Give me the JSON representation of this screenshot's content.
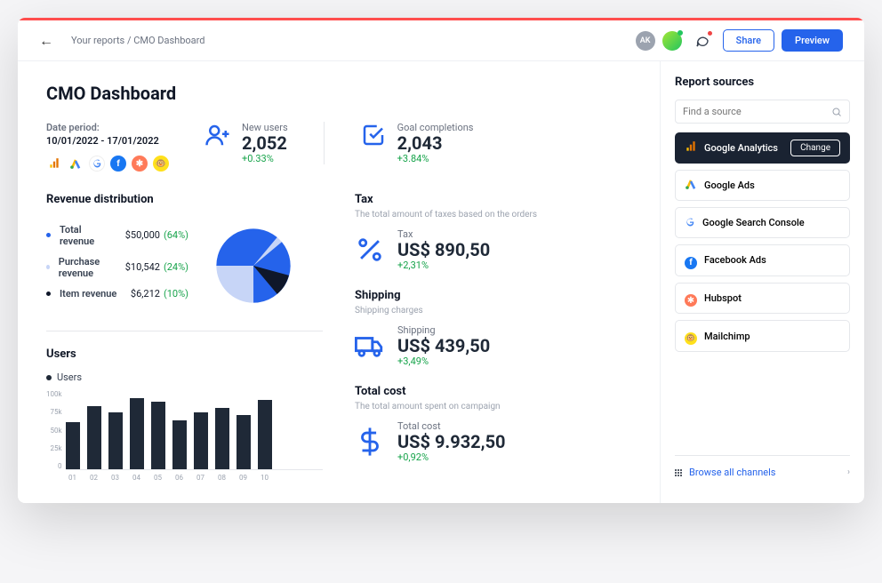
{
  "breadcrumb": "Your reports / CMO Dashboard",
  "header": {
    "avatar1": "AK",
    "share": "Share",
    "preview": "Preview"
  },
  "page_title": "CMO Dashboard",
  "date": {
    "label": "Date period:",
    "value": "10/01/2022 - 17/01/2022"
  },
  "top_sources": [
    "google-analytics",
    "google-ads",
    "google",
    "facebook",
    "hubspot",
    "mailchimp"
  ],
  "kpi": {
    "new_users": {
      "label": "New users",
      "value": "2,052",
      "delta": "+0.33%"
    },
    "goal": {
      "label": "Goal completions",
      "value": "2,043",
      "delta": "+3.84%"
    }
  },
  "revenue": {
    "title": "Revenue distribution",
    "rows": [
      {
        "label": "Total revenue",
        "value": "$50,000",
        "pct": "(64%)",
        "color": "#2563eb"
      },
      {
        "label": "Purchase revenue",
        "value": "$10,542",
        "pct": "(24%)",
        "color": "#c7d5f7"
      },
      {
        "label": "Item revenue",
        "value": "$6,212",
        "pct": "(10%)",
        "color": "#0f172a"
      }
    ]
  },
  "tax": {
    "title": "Tax",
    "sub": "The total amount of taxes based on the orders",
    "label": "Tax",
    "value": "US$ 890,50",
    "delta": "+2,31%"
  },
  "shipping": {
    "title": "Shipping",
    "sub": "Shipping charges",
    "label": "Shipping",
    "value": "US$ 439,50",
    "delta": "+3,49%"
  },
  "total": {
    "title": "Total cost",
    "sub": "The total amount spent on campaign",
    "label": "Total cost",
    "value": "US$ 9.932,50",
    "delta": "+0,92%"
  },
  "users_chart": {
    "title": "Users",
    "legend": "Users"
  },
  "sidebar": {
    "title": "Report sources",
    "search_placeholder": "Find a source",
    "change": "Change",
    "items": [
      {
        "name": "Google Analytics",
        "active": true
      },
      {
        "name": "Google Ads"
      },
      {
        "name": "Google Search Console"
      },
      {
        "name": "Facebook Ads"
      },
      {
        "name": "Hubspot"
      },
      {
        "name": "Mailchimp"
      }
    ],
    "browse": "Browse all channels"
  },
  "chart_data": [
    {
      "type": "pie",
      "title": "Revenue distribution",
      "series": [
        {
          "name": "Total revenue",
          "value": 50000,
          "pct": 64,
          "color": "#2563eb"
        },
        {
          "name": "Purchase revenue",
          "value": 10542,
          "pct": 24,
          "color": "#c7d5f7"
        },
        {
          "name": "Item revenue",
          "value": 6212,
          "pct": 10,
          "color": "#0f172a"
        }
      ]
    },
    {
      "type": "bar",
      "title": "Users",
      "ylabel": "",
      "xlabel": "",
      "ylim": [
        0,
        100000
      ],
      "yticks": [
        "100k",
        "75k",
        "50k",
        "25k",
        "0"
      ],
      "categories": [
        "01",
        "02",
        "03",
        "04",
        "05",
        "06",
        "07",
        "08",
        "09",
        "10"
      ],
      "values": [
        60000,
        80000,
        72000,
        90000,
        85000,
        62000,
        72000,
        78000,
        68000,
        88000
      ]
    }
  ]
}
